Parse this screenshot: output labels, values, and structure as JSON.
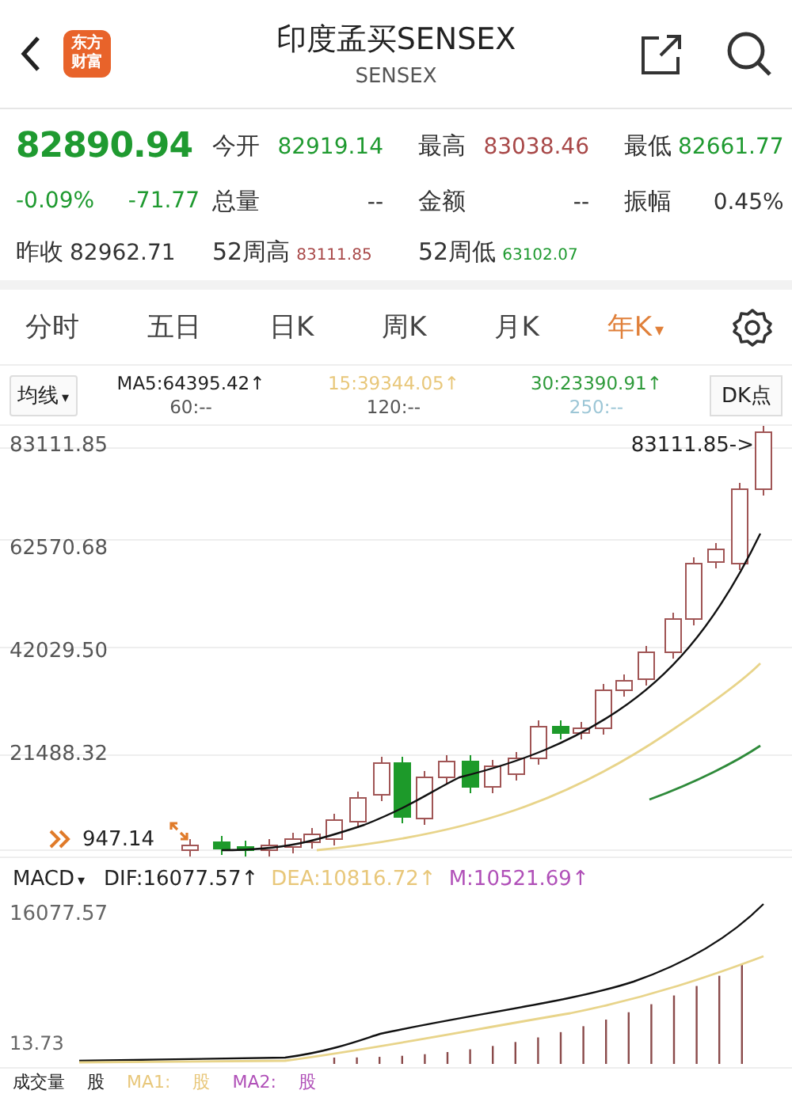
{
  "header": {
    "title": "印度孟买SENSEX",
    "subtitle": "SENSEX",
    "logo_lines": [
      "东方",
      "财富"
    ]
  },
  "quote": {
    "price": "82890.94",
    "change_pct": "-0.09%",
    "change": "-71.77",
    "prev_close_label": "昨收",
    "prev_close": "82962.71",
    "stats": [
      {
        "label": "今开",
        "value": "82919.14",
        "color": "#1f9a30"
      },
      {
        "label": "最高",
        "value": "83038.46",
        "color": "#a84848"
      },
      {
        "label": "最低",
        "value": "82661.77",
        "color": "#1f9a30"
      },
      {
        "label": "总量",
        "value": "--",
        "color": "#333333"
      },
      {
        "label": "金额",
        "value": "--",
        "color": "#333333"
      },
      {
        "label": "振幅",
        "value": "0.45%",
        "color": "#333333"
      },
      {
        "label": "52周高",
        "value": "83111.85",
        "color": "#a84848"
      },
      {
        "label": "52周低",
        "value": "63102.07",
        "color": "#1f9a30"
      }
    ]
  },
  "tabs": [
    {
      "label": "分时",
      "selected": false
    },
    {
      "label": "五日",
      "selected": false
    },
    {
      "label": "日K",
      "selected": false
    },
    {
      "label": "周K",
      "selected": false
    },
    {
      "label": "月K",
      "selected": false
    },
    {
      "label": "年K",
      "selected": true,
      "caret": "▾"
    }
  ],
  "ma_bar": {
    "selector": "均线",
    "caret": "▾",
    "button": "DK点",
    "items": [
      {
        "text": "MA5:64395.42↑",
        "color": "#222222"
      },
      {
        "text": "15:39344.05↑",
        "color": "#e8c77a"
      },
      {
        "text": "30:23390.91↑",
        "color": "#2e9a3a"
      },
      {
        "text": "60:--",
        "color": "#555555"
      },
      {
        "text": "120:--",
        "color": "#555555"
      },
      {
        "text": "250:--",
        "color": "#9cc6d6"
      }
    ]
  },
  "chart": {
    "y_labels": [
      "83111.85",
      "62570.68",
      "42029.50",
      "21488.32"
    ],
    "high_marker": "83111.85->",
    "low_marker": "947.14"
  },
  "macd": {
    "selector": "MACD",
    "caret": "▾",
    "y_labels": [
      "16077.57",
      "13.73"
    ],
    "items": [
      {
        "text": "DIF:16077.57↑",
        "color": "#222222"
      },
      {
        "text": "DEA:10816.72↑",
        "color": "#e8c77a"
      },
      {
        "text": "M:10521.69↑",
        "color": "#b050b8"
      }
    ]
  },
  "volume_bar": {
    "items": [
      {
        "text": "成交量",
        "color": "#222222"
      },
      {
        "text": "股",
        "color": "#222222"
      },
      {
        "text": "MA1:",
        "color": "#e8c77a"
      },
      {
        "text": "股",
        "color": "#e8c77a"
      },
      {
        "text": "MA2:",
        "color": "#b050b8"
      },
      {
        "text": "股",
        "color": "#b050b8"
      }
    ]
  }
}
